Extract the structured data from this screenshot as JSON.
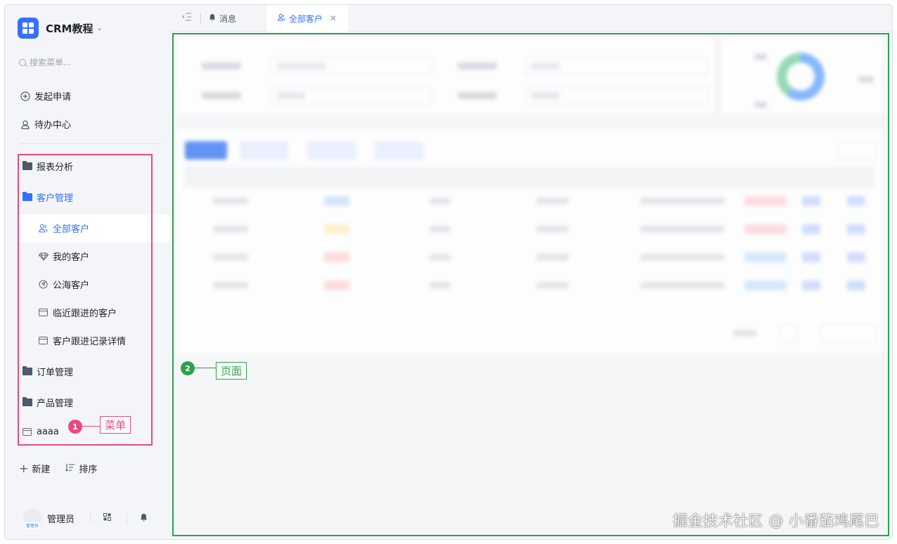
{
  "app": {
    "title": "CRM教程"
  },
  "search": {
    "placeholder": "搜索菜单..."
  },
  "quick": [
    {
      "label": "发起申请",
      "icon": "plus-circle-icon"
    },
    {
      "label": "待办中心",
      "icon": "user-icon"
    }
  ],
  "menu": {
    "reports": "报表分析",
    "customers": "客户管理",
    "customers_sub": [
      {
        "label": "全部客户",
        "icon": "users-icon"
      },
      {
        "label": "我的客户",
        "icon": "diamond-icon"
      },
      {
        "label": "公海客户",
        "icon": "compass-icon"
      },
      {
        "label": "临近跟进的客户",
        "icon": "card-icon"
      },
      {
        "label": "客户跟进记录详情",
        "icon": "card-icon"
      }
    ],
    "orders": "订单管理",
    "products": "产品管理",
    "custom": "aaaa"
  },
  "actions": {
    "new": "新建",
    "sort": "排序"
  },
  "user": {
    "name": "管理员",
    "avatar_text": "管理员"
  },
  "tabs": {
    "messages": "消息",
    "active": "全部客户"
  },
  "annotations": {
    "menu": {
      "number": "1",
      "label": "菜单"
    },
    "page": {
      "number": "2",
      "label": "页面"
    }
  },
  "watermark": "掘金技术社区 @ 小番茄鸡尾巴",
  "colors": {
    "accent": "#3370ff",
    "annot_pink": "#e84a7f",
    "annot_green": "#2ba24c"
  }
}
